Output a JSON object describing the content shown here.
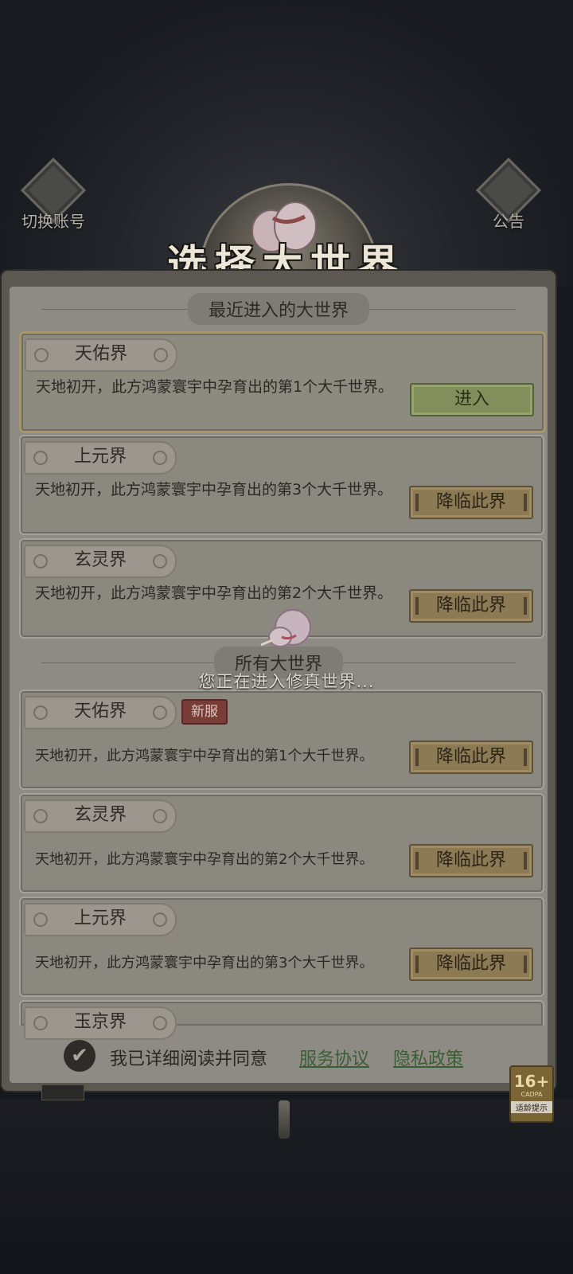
{
  "top_left": {
    "label": "切换账号",
    "icon": "account-switch-icon"
  },
  "top_right": {
    "label": "公告",
    "icon": "scroll-notice-icon"
  },
  "title": "选择大世界",
  "recent_section": {
    "header": "最近进入的大世界",
    "cards": [
      {
        "name": "天佑界",
        "desc": "天地初开，此方鸿蒙寰宇中孕育出的第1个大千世界。",
        "button": "进入"
      },
      {
        "name": "上元界",
        "desc": "天地初开，此方鸿蒙寰宇中孕育出的第3个大千世界。",
        "button": "降临此界"
      },
      {
        "name": "玄灵界",
        "desc": "天地初开，此方鸿蒙寰宇中孕育出的第2个大千世界。",
        "button": "降临此界"
      }
    ]
  },
  "all_section": {
    "header": "所有大世界",
    "cards": [
      {
        "name": "天佑界",
        "badge": "新服",
        "desc": "天地初开，此方鸿蒙寰宇中孕育出的第1个大千世界。",
        "button": "降临此界"
      },
      {
        "name": "玄灵界",
        "desc": "天地初开，此方鸿蒙寰宇中孕育出的第2个大千世界。",
        "button": "降临此界"
      },
      {
        "name": "上元界",
        "desc": "天地初开，此方鸿蒙寰宇中孕育出的第3个大千世界。",
        "button": "降临此界"
      },
      {
        "name": "玉京界"
      }
    ]
  },
  "loading_text": "您正在进入修真世界...",
  "agreement": {
    "check_icon": "checkmark-icon",
    "text": "我已详细阅读并同意",
    "terms": "服务协议",
    "privacy": "隐私政策"
  },
  "age_badge": {
    "rating": "16+",
    "cadpa": "CADPA",
    "tip": "适龄提示"
  },
  "colors": {
    "enter_button": "#828f5c",
    "descend_button": "#8c7a55",
    "new_badge": "#7a3c36",
    "link": "#3a5e36"
  }
}
